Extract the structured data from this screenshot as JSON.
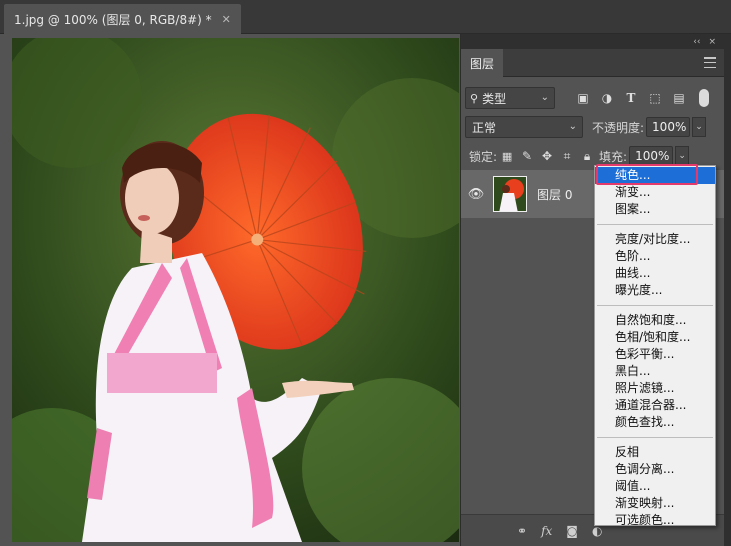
{
  "document": {
    "tab_title": "1.jpg @ 100% (图层 0, RGB/8#) *",
    "close_icon": "close-icon"
  },
  "panel": {
    "collapse_glyph": "‹‹",
    "close_glyph": "×",
    "tab_label": "图层",
    "filter_kind": "类型",
    "blend_mode": "正常",
    "opacity_label": "不透明度:",
    "opacity_value": "100%",
    "lock_label": "锁定:",
    "fill_label": "填充:",
    "fill_value": "100%",
    "layers": [
      {
        "name": "图层 0",
        "visible": true
      }
    ]
  },
  "adjustment_menu": {
    "groups": [
      [
        "纯色...",
        "渐变...",
        "图案..."
      ],
      [
        "亮度/对比度...",
        "色阶...",
        "曲线...",
        "曝光度..."
      ],
      [
        "自然饱和度...",
        "色相/饱和度...",
        "色彩平衡...",
        "黑白...",
        "照片滤镜...",
        "通道混合器...",
        "颜色查找..."
      ],
      [
        "反相",
        "色调分离...",
        "阈值...",
        "渐变映射...",
        "可选颜色..."
      ]
    ],
    "selected_item": "纯色..."
  },
  "colors": {
    "accent_selected": "#1d6ed6",
    "highlight_box": "#e43a6b",
    "umbrella": "#e8401e"
  }
}
